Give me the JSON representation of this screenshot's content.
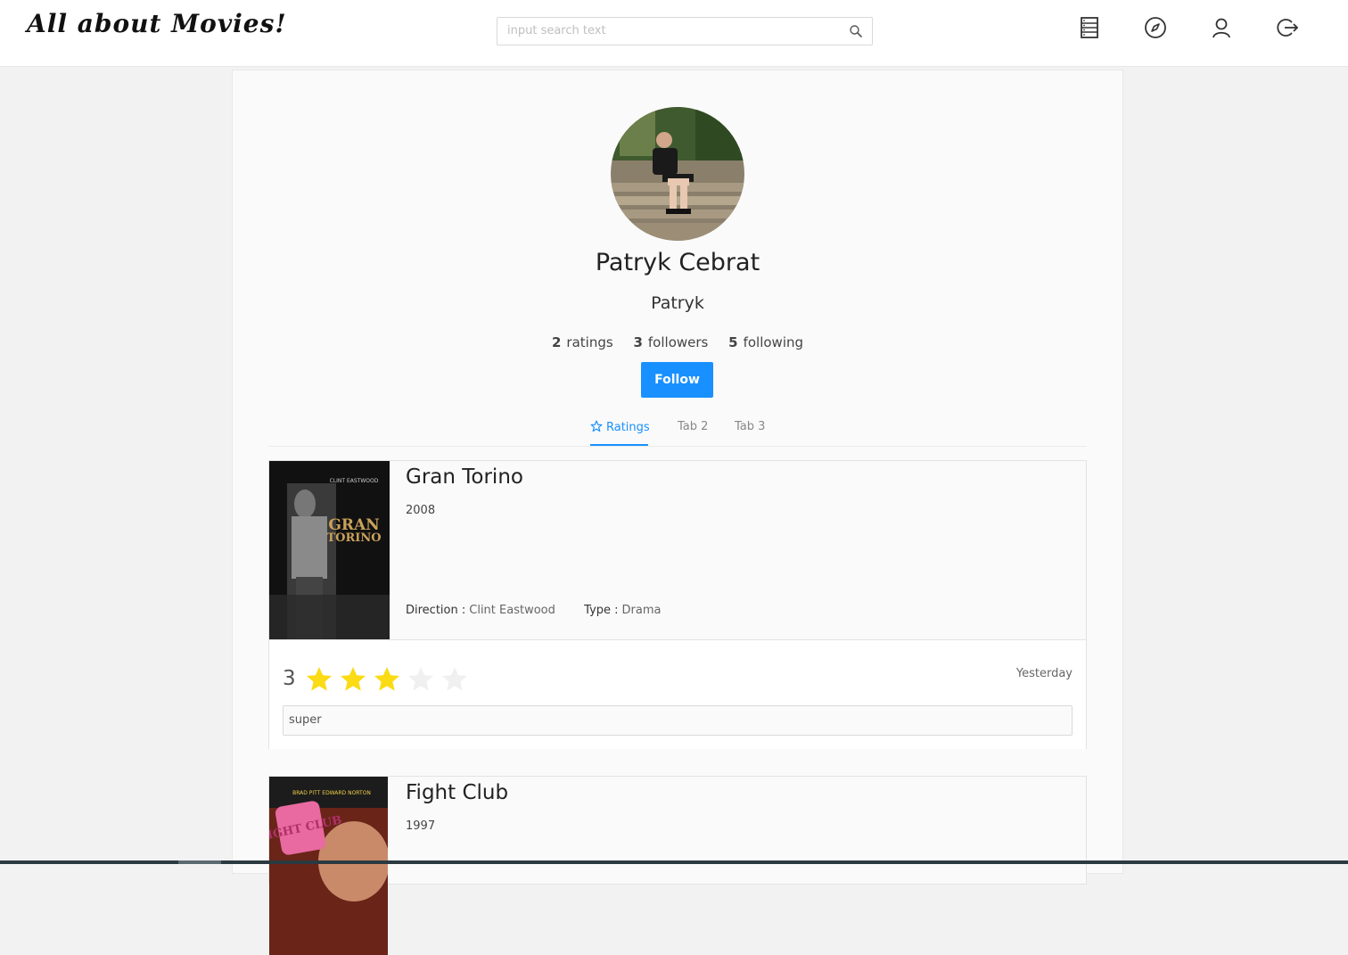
{
  "header": {
    "logo": "All about Movies!",
    "search_placeholder": "input search text",
    "nav_icons": [
      "list-icon",
      "compass-icon",
      "user-icon",
      "logout-icon"
    ]
  },
  "profile": {
    "name": "Patryk Cebrat",
    "nickname": "Patryk",
    "stats": [
      {
        "count": "2",
        "label": "ratings"
      },
      {
        "count": "3",
        "label": "followers"
      },
      {
        "count": "5",
        "label": "following"
      }
    ],
    "follow_label": "Follow"
  },
  "tabs": [
    {
      "label": "Ratings",
      "active": true
    },
    {
      "label": "Tab 2",
      "active": false
    },
    {
      "label": "Tab 3",
      "active": false
    }
  ],
  "movies": [
    {
      "title": "Gran Torino",
      "year": "2008",
      "direction_label": "Direction",
      "direction": "Clint Eastwood",
      "type_label": "Type",
      "type": "Drama",
      "rating": "3",
      "rating_value": 3,
      "rating_max": 5,
      "date": "Yesterday",
      "comment": "super",
      "poster_text": [
        "CLINT EASTWOOD",
        "GRAN",
        "TORINO"
      ]
    },
    {
      "title": "Fight Club",
      "year": "1997",
      "poster_text": [
        "BRAD PITT  EDWARD NORTON",
        "FIGHT CLUB"
      ]
    }
  ],
  "colors": {
    "accent": "#1890ff",
    "star_filled": "#fadb14",
    "star_empty": "#f0f0f0"
  }
}
